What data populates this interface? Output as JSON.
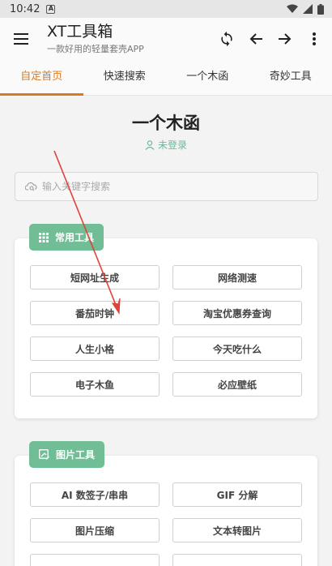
{
  "status": {
    "time": "10:42",
    "notif_letter": "A"
  },
  "appbar": {
    "title": "XT工具箱",
    "subtitle": "一款好用的轻量套壳APP"
  },
  "tabs": [
    {
      "label": "自定首页",
      "active": true
    },
    {
      "label": "快速搜索"
    },
    {
      "label": "一个木函"
    },
    {
      "label": "奇妙工具"
    }
  ],
  "page": {
    "title": "一个木函",
    "login": "未登录"
  },
  "search": {
    "placeholder": "输入关键字搜索"
  },
  "sections": {
    "common": {
      "title": "常用工具",
      "items": [
        "短网址生成",
        "网络测速",
        "番茄时钟",
        "淘宝优惠券查询",
        "人生小格",
        "今天吃什么",
        "电子木鱼",
        "必应壁纸"
      ]
    },
    "image": {
      "title": "图片工具",
      "items": [
        "AI 数签子/串串",
        "GIF 分解",
        "图片压缩",
        "文本转图片"
      ]
    }
  },
  "colors": {
    "accent": "#d87a22",
    "green": "#71bd95",
    "annotation": "#e0413a"
  }
}
